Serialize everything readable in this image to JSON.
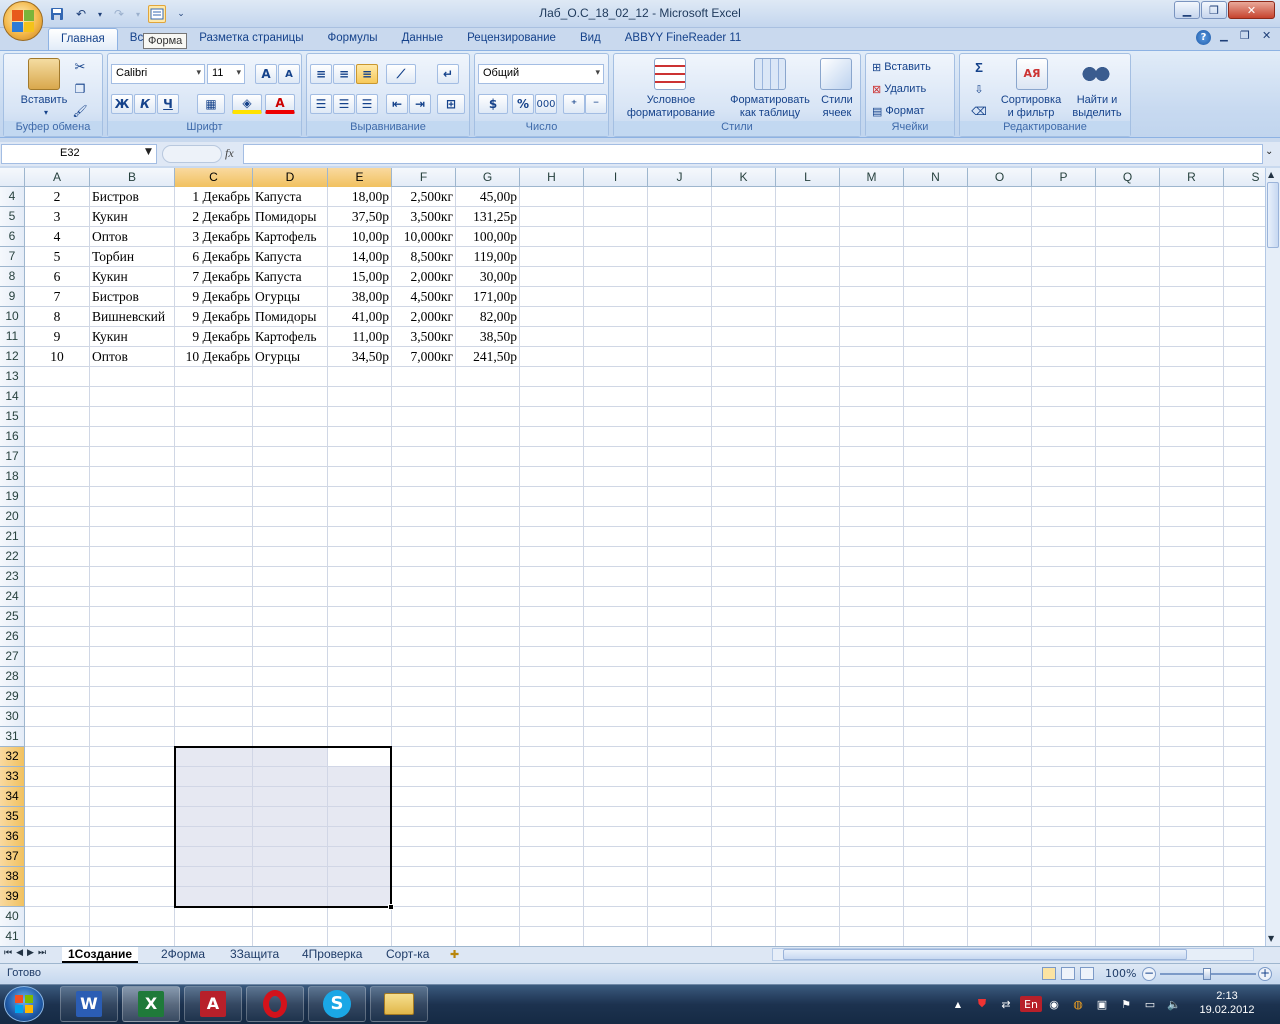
{
  "window": {
    "title": "Лаб_О.С_18_02_12 - Microsoft Excel"
  },
  "tooltip": "Форма",
  "tabs": [
    "Главная",
    "Вс",
    "Разметка страницы",
    "Формулы",
    "Данные",
    "Рецензирование",
    "Вид",
    "ABBYY FineReader 11"
  ],
  "ribbon": {
    "clipboard": {
      "paste": "Вставить",
      "label": "Буфер обмена"
    },
    "font": {
      "name": "Calibri",
      "size": "11",
      "bold": "Ж",
      "italic": "К",
      "underline": "Ч",
      "grow": "A",
      "shrink": "A",
      "color_letter": "A",
      "label": "Шрифт"
    },
    "alignment": {
      "label": "Выравнивание"
    },
    "number": {
      "format": "Общий",
      "percent": "%",
      "thousands": "000",
      "label": "Число"
    },
    "styles": {
      "conditional": [
        "Условное",
        "форматирование"
      ],
      "as_table": [
        "Форматировать",
        "как таблицу"
      ],
      "cell_styles": [
        "Стили",
        "ячеек"
      ],
      "label": "Стили"
    },
    "cells": {
      "insert": "Вставить",
      "delete": "Удалить",
      "format": "Формат",
      "label": "Ячейки"
    },
    "editing": {
      "sum": "Σ",
      "sort": [
        "Сортировка",
        "и фильтр"
      ],
      "find": [
        "Найти и",
        "выделить"
      ],
      "label": "Редактирование"
    }
  },
  "formula_bar": {
    "name_box": "E32",
    "fx": "fx",
    "value": ""
  },
  "columns": [
    "A",
    "B",
    "C",
    "D",
    "E",
    "F",
    "G",
    "H",
    "I",
    "J",
    "K",
    "L",
    "M",
    "N",
    "O",
    "P",
    "Q",
    "R",
    "S"
  ],
  "selected_columns": [
    "C",
    "D",
    "E"
  ],
  "rows": [
    {
      "n": "4",
      "A": "2",
      "B": "Бистров",
      "C": "1 Декабрь",
      "D": "Капуста",
      "E": "18,00р",
      "F": "2,500кг",
      "G": "45,00р"
    },
    {
      "n": "5",
      "A": "3",
      "B": "Кукин",
      "C": "2 Декабрь",
      "D": "Помидоры",
      "E": "37,50р",
      "F": "3,500кг",
      "G": "131,25р"
    },
    {
      "n": "6",
      "A": "4",
      "B": "Оптов",
      "C": "3 Декабрь",
      "D": "Картофель",
      "E": "10,00р",
      "F": "10,000кг",
      "G": "100,00р"
    },
    {
      "n": "7",
      "A": "5",
      "B": "Торбин",
      "C": "6 Декабрь",
      "D": "Капуста",
      "E": "14,00р",
      "F": "8,500кг",
      "G": "119,00р"
    },
    {
      "n": "8",
      "A": "6",
      "B": "Кукин",
      "C": "7 Декабрь",
      "D": "Капуста",
      "E": "15,00р",
      "F": "2,000кг",
      "G": "30,00р"
    },
    {
      "n": "9",
      "A": "7",
      "B": "Бистров",
      "C": "9 Декабрь",
      "D": "Огурцы",
      "E": "38,00р",
      "F": "4,500кг",
      "G": "171,00р"
    },
    {
      "n": "10",
      "A": "8",
      "B": "Вишневский",
      "C": "9 Декабрь",
      "D": "Помидоры",
      "E": "41,00р",
      "F": "2,000кг",
      "G": "82,00р"
    },
    {
      "n": "11",
      "A": "9",
      "B": "Кукин",
      "C": "9 Декабрь",
      "D": "Картофель",
      "E": "11,00р",
      "F": "3,500кг",
      "G": "38,50р"
    },
    {
      "n": "12",
      "A": "10",
      "B": "Оптов",
      "C": "10 Декабрь",
      "D": "Огурцы",
      "E": "34,50р",
      "F": "7,000кг",
      "G": "241,50р"
    }
  ],
  "empty_rows": [
    "13",
    "14",
    "15",
    "16",
    "17",
    "18",
    "19",
    "20",
    "21",
    "22",
    "23",
    "24",
    "25",
    "26",
    "27",
    "28",
    "29",
    "30",
    "31",
    "32",
    "33",
    "34",
    "35",
    "36",
    "37",
    "38",
    "39",
    "40",
    "41"
  ],
  "selected_rows": [
    "32",
    "33",
    "34",
    "35",
    "36",
    "37",
    "38",
    "39"
  ],
  "sheets": [
    "1Создание",
    "2Форма",
    "3Защита",
    "4Проверка",
    "Сорт-ка"
  ],
  "active_sheet": "1Создание",
  "status": {
    "ready": "Готово",
    "zoom": "100%"
  },
  "taskbar": {
    "apps": [
      "word",
      "excel",
      "acrobat",
      "opera",
      "skype",
      "explorer"
    ],
    "lang": "En",
    "time": "2:13",
    "date": "19.02.2012"
  }
}
